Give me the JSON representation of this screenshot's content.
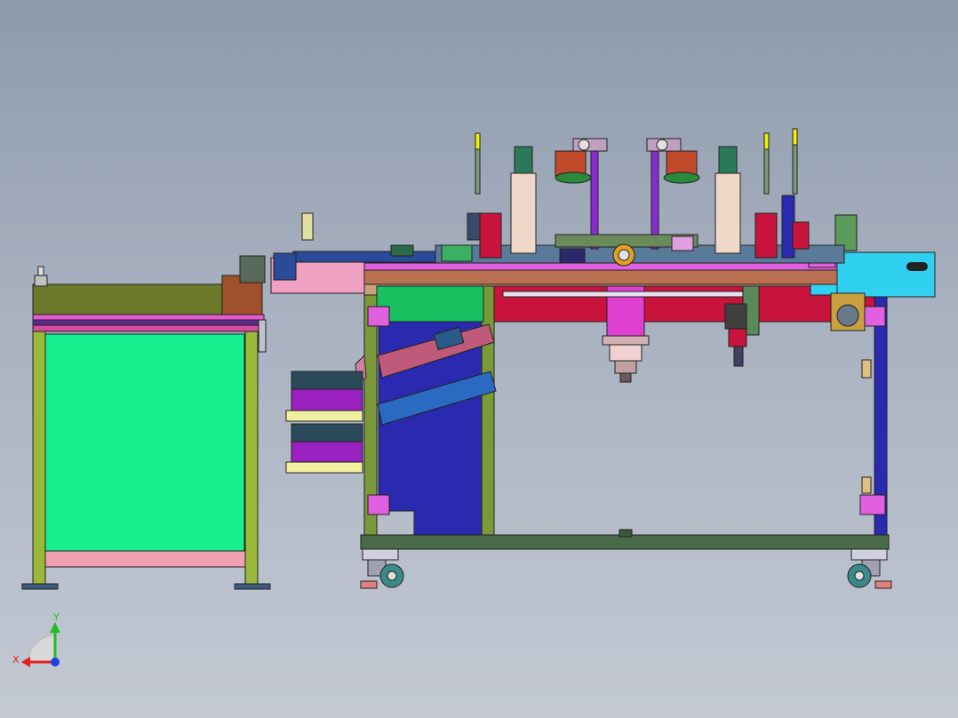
{
  "viewport": {
    "background_top": "#8e9aab",
    "background_bottom": "#c4c9d3"
  },
  "triad": {
    "x_label": "X",
    "y_label": "Y",
    "x_color": "#e02020",
    "y_color": "#20c020",
    "z_color": "#2040e0"
  },
  "palette": {
    "frame_olive": "#7a9a3a",
    "frame_dark_green": "#4a6b4a",
    "panel_green": "#18f090",
    "table_top_brown": "#b87050",
    "manifold_red": "#c8143c",
    "magenta": "#e040e0",
    "purple": "#8a2ad0",
    "navy": "#2a2ab0",
    "blue_chute": "#2a6ac0",
    "cyan": "#30d0f0",
    "pink": "#f09ab0",
    "yellow": "#f0f000",
    "caster_teal": "#3a8a8a"
  }
}
